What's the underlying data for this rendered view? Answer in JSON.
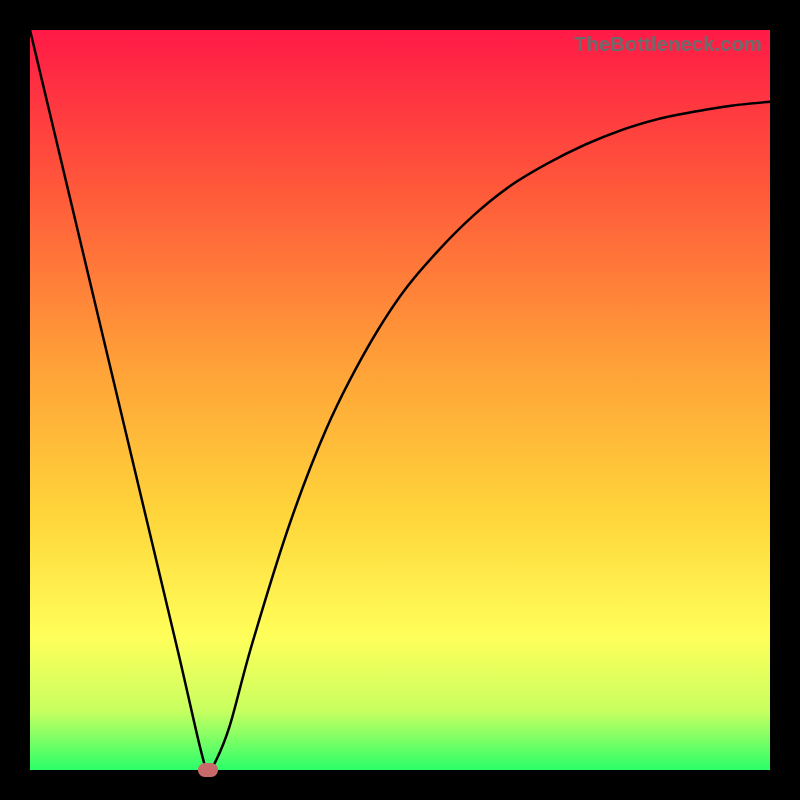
{
  "watermark": "TheBottleneck.com",
  "chart_data": {
    "type": "line",
    "title": "",
    "xlabel": "",
    "ylabel": "",
    "xlim": [
      0,
      100
    ],
    "ylim": [
      0,
      100
    ],
    "grid": false,
    "legend": false,
    "series": [
      {
        "name": "curve",
        "x": [
          0,
          5,
          10,
          15,
          20,
          23,
          24,
          25,
          27,
          30,
          35,
          40,
          45,
          50,
          55,
          60,
          65,
          70,
          75,
          80,
          85,
          90,
          95,
          100
        ],
        "y": [
          100,
          79,
          58,
          37,
          16,
          3,
          0,
          1,
          6,
          17,
          33,
          46,
          56,
          64,
          70,
          75,
          79,
          82,
          84.5,
          86.5,
          88,
          89,
          89.8,
          90.3
        ]
      }
    ],
    "marker": {
      "x": 24,
      "y": 0,
      "color": "#c96a6a"
    },
    "background_gradient": {
      "top": "#ff1a46",
      "bottom": "#2aff6a"
    }
  }
}
